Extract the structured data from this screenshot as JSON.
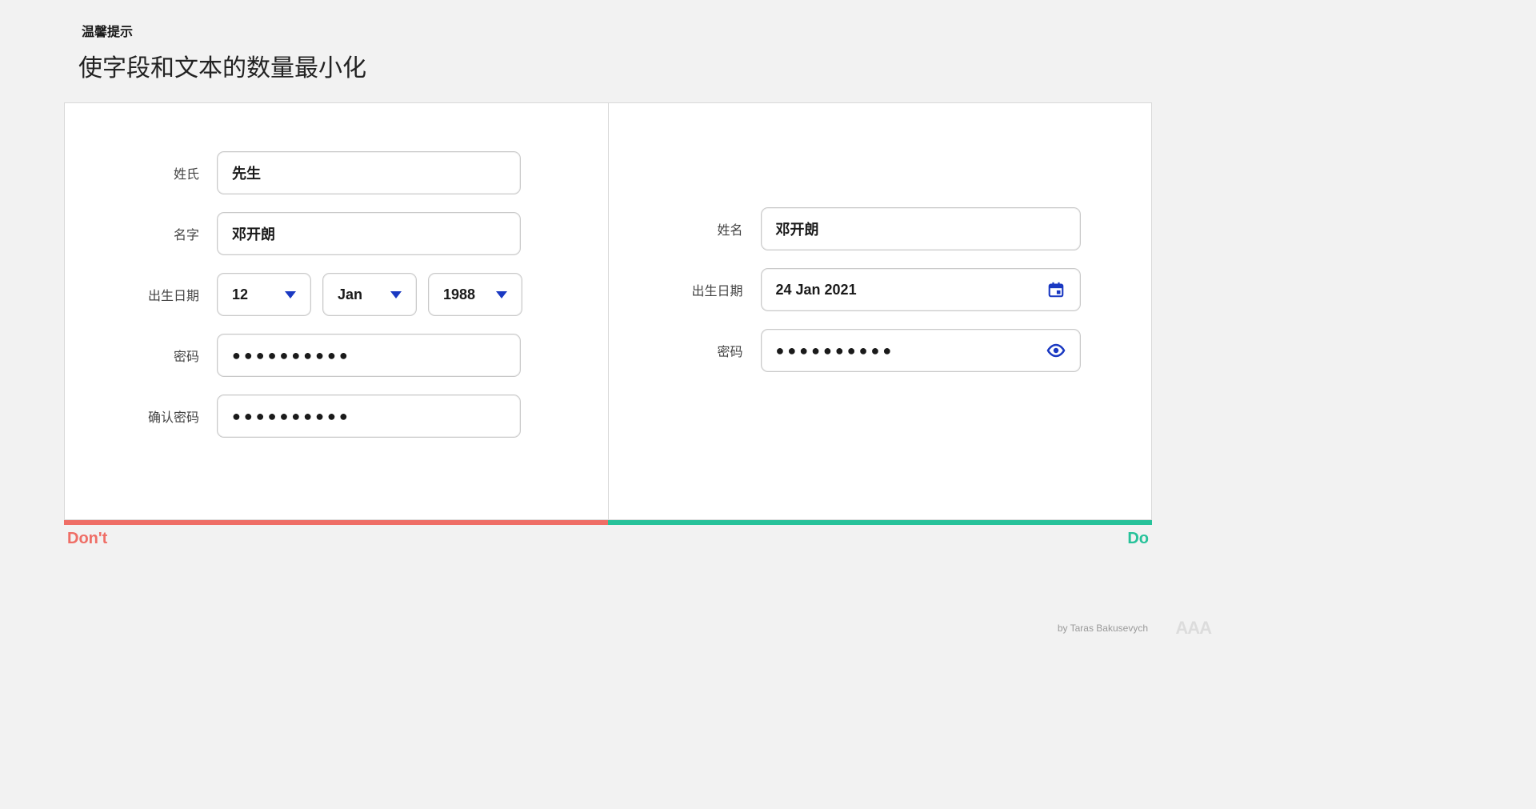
{
  "header": {
    "pretitle": "温馨提示",
    "title": "使字段和文本的数量最小化"
  },
  "dont": {
    "surname_label": "姓氏",
    "surname_value": "先生",
    "firstname_label": "名字",
    "firstname_value": "邓开朗",
    "dob_label": "出生日期",
    "dob_day": "12",
    "dob_month": "Jan",
    "dob_year": "1988",
    "password_label": "密码",
    "password_value": "●●●●●●●●●●",
    "confirm_label": "确认密码",
    "confirm_value": "●●●●●●●●●●"
  },
  "do": {
    "name_label": "姓名",
    "name_value": "邓开朗",
    "dob_label": "出生日期",
    "dob_value": "24 Jan 2021",
    "password_label": "密码",
    "password_value": "●●●●●●●●●●"
  },
  "tags": {
    "dont": "Don't",
    "do": "Do"
  },
  "footer": {
    "byline": "by Taras Bakusevych",
    "watermark": "AAA"
  },
  "colors": {
    "dont": "#ef6e66",
    "do": "#27c29a",
    "accent": "#1a39c2"
  }
}
